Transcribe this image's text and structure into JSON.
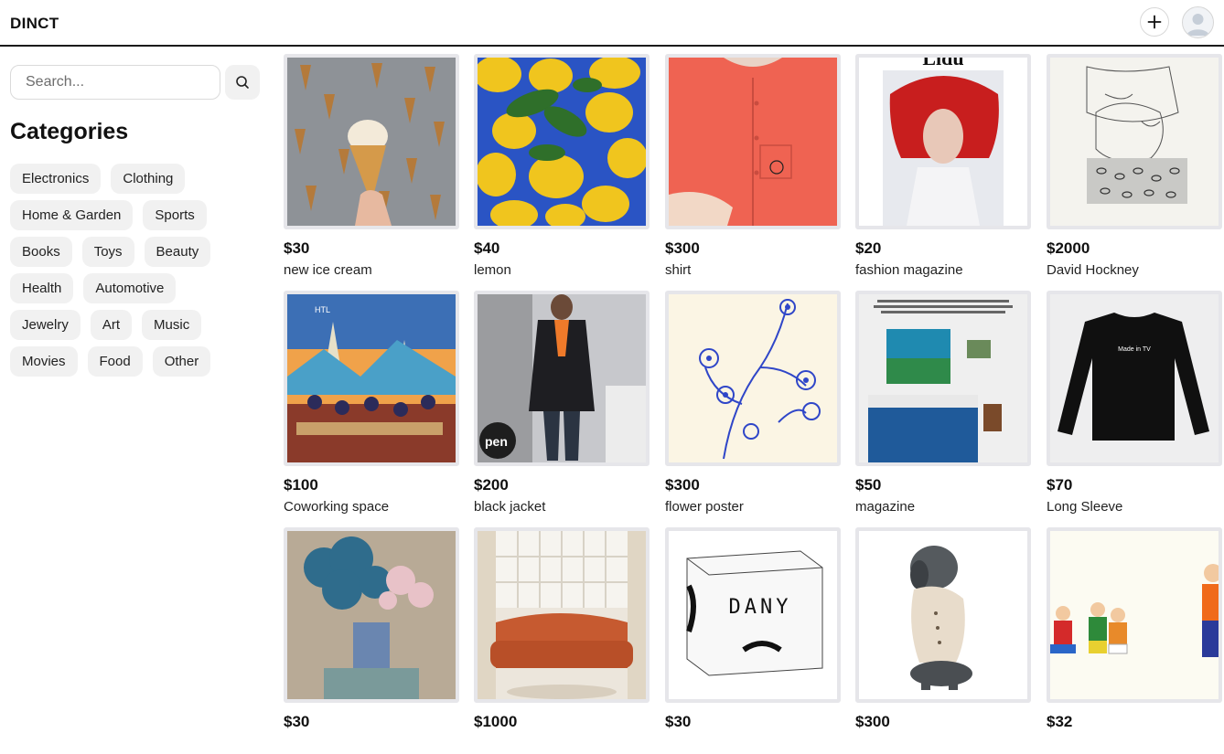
{
  "header": {
    "brand": "DINCT"
  },
  "sidebar": {
    "search_placeholder": "Search...",
    "categories_title": "Categories",
    "categories": [
      "Electronics",
      "Clothing",
      "Home & Garden",
      "Sports",
      "Books",
      "Toys",
      "Beauty",
      "Health",
      "Automotive",
      "Jewelry",
      "Art",
      "Music",
      "Movies",
      "Food",
      "Other"
    ]
  },
  "products": [
    {
      "price": "$30",
      "title": "new ice cream",
      "image": "ice-cream-cones-on-grey-wall"
    },
    {
      "price": "$40",
      "title": "lemon",
      "image": "lemons-in-blue-crate"
    },
    {
      "price": "$300",
      "title": "shirt",
      "image": "coral-button-shirt"
    },
    {
      "price": "$20",
      "title": "fashion magazine",
      "image": "magazine-cover-red-hat"
    },
    {
      "price": "$2000",
      "title": "David Hockney",
      "image": "pencil-drawing"
    },
    {
      "price": "$100",
      "title": "Coworking space",
      "image": "coworking-illustration"
    },
    {
      "price": "$200",
      "title": "black jacket",
      "image": "person-black-blazer"
    },
    {
      "price": "$300",
      "title": "flower poster",
      "image": "blue-flower-line-art"
    },
    {
      "price": "$50",
      "title": "magazine",
      "image": "magazine-bedroom-collage"
    },
    {
      "price": "$70",
      "title": "Long Sleeve",
      "image": "black-long-sleeve-tee"
    },
    {
      "price": "$30",
      "title": "",
      "image": "blue-pink-flower-vase"
    },
    {
      "price": "$1000",
      "title": "",
      "image": "orange-sofa-room"
    },
    {
      "price": "$30",
      "title": "",
      "image": "dany-box-packaging"
    },
    {
      "price": "$300",
      "title": "",
      "image": "dog-in-sweater"
    },
    {
      "price": "$32",
      "title": "",
      "image": "toy-figures"
    }
  ],
  "image_texts": {
    "coworking_sign": "HTL",
    "jacket_sign": "pen",
    "magazine_header": "Lidu",
    "longsleeve_print": "Made in TV",
    "box_brand": "DANY"
  },
  "colors": {
    "header_rule": "#1a1a1a",
    "chip_bg": "#f1f1f1",
    "thumb_border": "#e6e6ea"
  }
}
